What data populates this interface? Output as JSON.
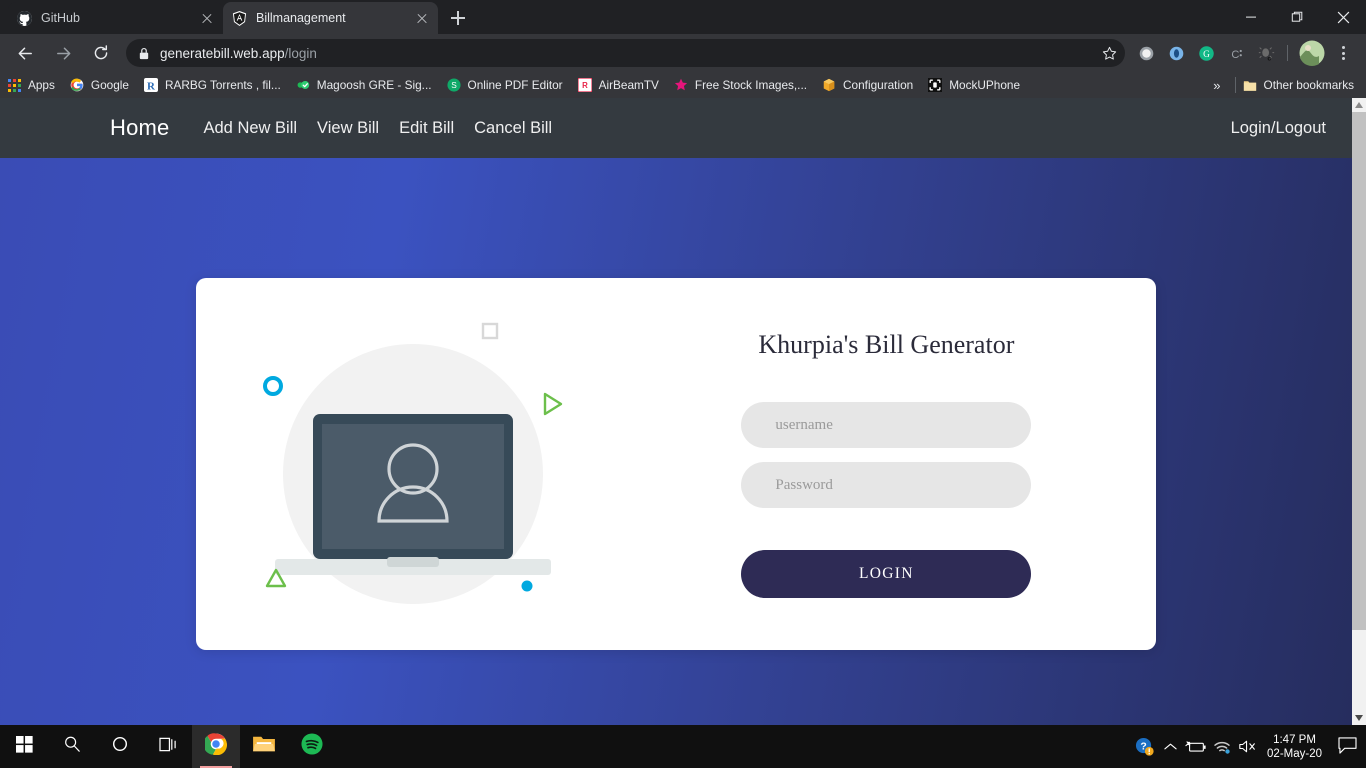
{
  "browser": {
    "tabs": [
      {
        "title": "GitHub",
        "favicon": "github-icon",
        "active": false
      },
      {
        "title": "Billmanagement",
        "favicon": "angular-icon",
        "active": true
      }
    ],
    "new_tab_label": "+",
    "window_controls": [
      "minimize",
      "restore",
      "close"
    ],
    "omnibox": {
      "url_secure": "generatebill.web.app",
      "url_path": "/login",
      "lock_icon": "lock-icon",
      "star_icon": "star-icon"
    },
    "nav_buttons": [
      "back-arrow-icon",
      "forward-arrow-icon",
      "reload-icon"
    ],
    "extensions": [
      "grey-circle-ext-icon",
      "blue-circle-ext-icon",
      "grammarly-icon",
      "colon-c-ext-icon",
      "bug-ext-icon"
    ],
    "profile": "avatar",
    "menu": "kebab-menu-icon",
    "bookmarks": [
      {
        "label": "Apps",
        "icon": "apps-grid-icon"
      },
      {
        "label": "Google",
        "icon": "google-icon"
      },
      {
        "label": "RARBG Torrents , fil...",
        "icon": "rarbg-icon"
      },
      {
        "label": "Magoosh GRE - Sig...",
        "icon": "magoosh-icon"
      },
      {
        "label": "Online PDF Editor",
        "icon": "smallpdf-icon"
      },
      {
        "label": "AirBeamTV",
        "icon": "airbeamtv-icon"
      },
      {
        "label": "Free Stock Images,...",
        "icon": "star-pink-icon"
      },
      {
        "label": "Configuration",
        "icon": "package-icon"
      },
      {
        "label": "MockUPhone",
        "icon": "mockuphone-icon"
      }
    ],
    "bookmarks_overflow": "»",
    "other_bookmarks": {
      "label": "Other bookmarks",
      "icon": "folder-icon"
    }
  },
  "app": {
    "brand": "Home",
    "nav_links": [
      "Add New Bill",
      "View Bill",
      "Edit Bill",
      "Cancel Bill"
    ],
    "nav_right": "Login/Logout",
    "login": {
      "title": "Khurpia's Bill Generator",
      "username_placeholder": "username",
      "username_value": "",
      "password_placeholder": "Password",
      "password_value": "",
      "submit_label": "LOGIN"
    },
    "illustration": {
      "name": "laptop-user-login-illustration",
      "circle_color": "#f2f2f2",
      "laptop_bezel_color": "#374a58",
      "laptop_screen_color": "#4b5b69",
      "person_color": "#cfd4d7",
      "base_color": "#e3e8e8",
      "accents": [
        {
          "shape": "square-outline",
          "color": "#d8d8d8"
        },
        {
          "shape": "circle-outline",
          "color": "#00a9e0"
        },
        {
          "shape": "triangle-outline-right",
          "color": "#6cbf4b"
        },
        {
          "shape": "triangle-outline-up",
          "color": "#6cbf4b"
        },
        {
          "shape": "circle-filled",
          "color": "#00a9e0"
        }
      ]
    },
    "colors": {
      "navbar": "#343a40",
      "hero_gradient_start": "#3a4cb5",
      "hero_gradient_end": "#262d5e",
      "button": "#2e2b55",
      "field": "#e6e6e6"
    }
  },
  "taskbar": {
    "items": [
      {
        "name": "start-button",
        "icon": "windows-logo-icon"
      },
      {
        "name": "search-button",
        "icon": "search-icon"
      },
      {
        "name": "cortana-button",
        "icon": "cortana-circle-icon"
      },
      {
        "name": "task-view-button",
        "icon": "task-view-icon"
      },
      {
        "name": "chrome-taskbar-button",
        "icon": "chrome-icon"
      },
      {
        "name": "file-explorer-taskbar-button",
        "icon": "folder-icon"
      },
      {
        "name": "spotify-taskbar-button",
        "icon": "spotify-icon"
      }
    ],
    "tray": [
      "help-alert-icon",
      "chevron-up-icon",
      "battery-charging-icon",
      "wifi-icon",
      "speaker-muted-icon"
    ],
    "clock_time": "1:47 PM",
    "clock_date": "02-May-20",
    "action_center": "action-center-icon"
  }
}
